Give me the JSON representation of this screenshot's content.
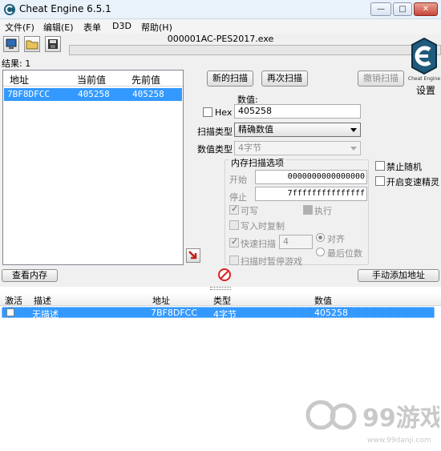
{
  "window": {
    "title": "Cheat Engine 6.5.1",
    "process": "000001AC-PES2017.exe"
  },
  "menu": [
    "文件(F)",
    "编辑(E)",
    "表单",
    "D3D",
    "帮助(H)"
  ],
  "results_label": "结果: 1",
  "found_list": {
    "columns": [
      "地址",
      "当前值",
      "先前值"
    ],
    "rows": [
      {
        "address": "7BF8DFCC",
        "value": "405258",
        "previous": "405258"
      }
    ]
  },
  "scan": {
    "new_scan": "新的扫描",
    "next_scan": "再次扫描",
    "undo_scan": "撤销扫描",
    "settings": "设置",
    "value_label": "数值:",
    "hex_label": "Hex",
    "value": "405258",
    "scan_type_label": "扫描类型",
    "scan_type": "精确数值",
    "value_type_label": "数值类型",
    "value_type": "4字节"
  },
  "memory_options": {
    "title": "内存扫描选项",
    "start_label": "开始",
    "start_value": "0000000000000000",
    "stop_label": "停止",
    "stop_value": "7fffffffffffffff",
    "writable": "可写",
    "executable": "执行",
    "copy_on_write": "写入时复制",
    "fast_scan": "快速扫描",
    "fast_scan_value": "4",
    "align": "对齐",
    "last_digits": "最后位数",
    "pause_game": "扫描时暂停游戏"
  },
  "right_options": {
    "no_random": "禁止随机",
    "speedhack": "开启变速精灵"
  },
  "bottom_buttons": {
    "view_memory": "查看内存",
    "add_address": "手动添加地址"
  },
  "address_list": {
    "columns": [
      "激活",
      "描述",
      "地址",
      "类型",
      "数值"
    ],
    "rows": [
      {
        "description": "无描述",
        "address": "7BF8DFCC",
        "type": "4字节",
        "value": "405258"
      }
    ]
  },
  "watermark": {
    "brand": "99游戏",
    "url": "www.99danji.com"
  },
  "logo_text": "Cheat Engine"
}
